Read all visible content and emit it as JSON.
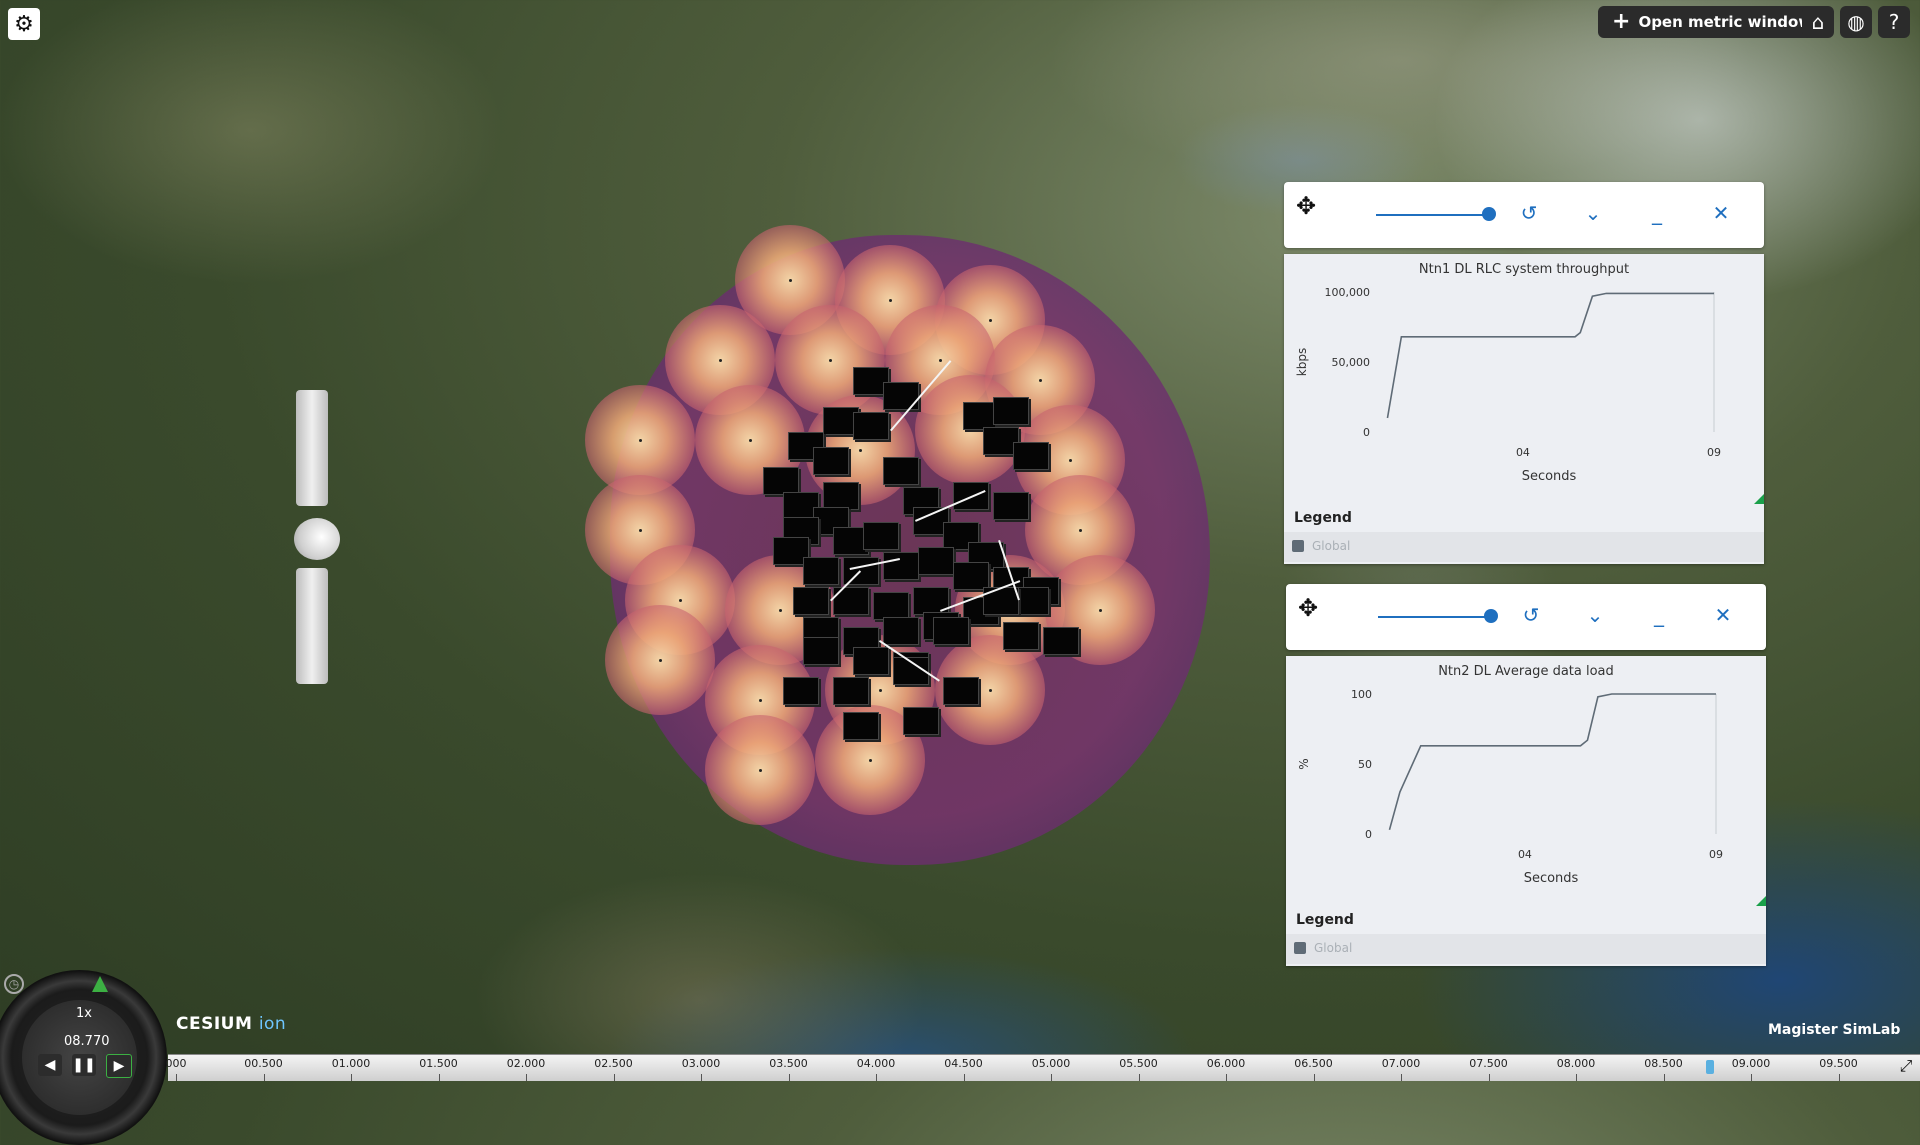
{
  "toolbar": {
    "open_metric_label": "Open metric window"
  },
  "windows": [
    {
      "title": "Ntn1 DL RLC system throughput",
      "chart_data": {
        "type": "line",
        "title": "Ntn1 DL RLC system throughput",
        "xlabel": "Seconds",
        "ylabel": "kbps",
        "yticks": [
          "0",
          "50,000",
          "100,000"
        ],
        "xticks": [
          "04",
          "09"
        ],
        "ylim": [
          0,
          100000
        ],
        "xlim": [
          0,
          9.5
        ],
        "legend": "bottom",
        "series": [
          {
            "name": "Global",
            "x": [
              0.1,
              0.5,
              0.75,
              5.5,
              5.65,
              6.0,
              6.4,
              9.5
            ],
            "y": [
              10000,
              68000,
              68000,
              68000,
              71000,
              97000,
              99000,
              99000
            ]
          }
        ]
      },
      "legend_title": "Legend",
      "legend_item": "Global"
    },
    {
      "title": "Ntn2 DL Average data load",
      "chart_data": {
        "type": "line",
        "title": "Ntn2 DL Average data load",
        "xlabel": "Seconds",
        "ylabel": "%",
        "yticks": [
          "0",
          "50",
          "100"
        ],
        "xticks": [
          "04",
          "09"
        ],
        "ylim": [
          0,
          100
        ],
        "xlim": [
          0,
          9.5
        ],
        "legend": "bottom",
        "series": [
          {
            "name": "Global",
            "x": [
              0.1,
              0.4,
              1.0,
              5.6,
              5.8,
              6.1,
              6.5,
              9.5
            ],
            "y": [
              3,
              30,
              63,
              63,
              67,
              98,
              100,
              100
            ]
          }
        ]
      },
      "legend_title": "Legend",
      "legend_item": "Global"
    }
  ],
  "animation": {
    "speed": "1x",
    "time": "08.770"
  },
  "branding": {
    "cesium": "CESIUM",
    "cesium_ion": "ion",
    "magister": "Magister SimLab"
  },
  "timeline": {
    "labels": [
      "000",
      "00.500",
      "01.000",
      "01.500",
      "02.000",
      "02.500",
      "03.000",
      "03.500",
      "04.000",
      "04.500",
      "05.000",
      "05.500",
      "06.000",
      "06.500",
      "07.000",
      "07.500",
      "08.000",
      "08.500",
      "09.000",
      "09.500"
    ]
  },
  "icons": {
    "settings": "gear-icon",
    "home": "home-icon",
    "globe": "globe-icon",
    "help": "help-icon",
    "move": "move-icon",
    "history": "history-icon",
    "chevron": "chevron-down-icon",
    "minimize": "minimize-icon",
    "close": "close-icon"
  },
  "colors": {
    "accent": "#1f6fbf",
    "line": "#5f6b76",
    "resize_corner": "#1aa04a"
  }
}
